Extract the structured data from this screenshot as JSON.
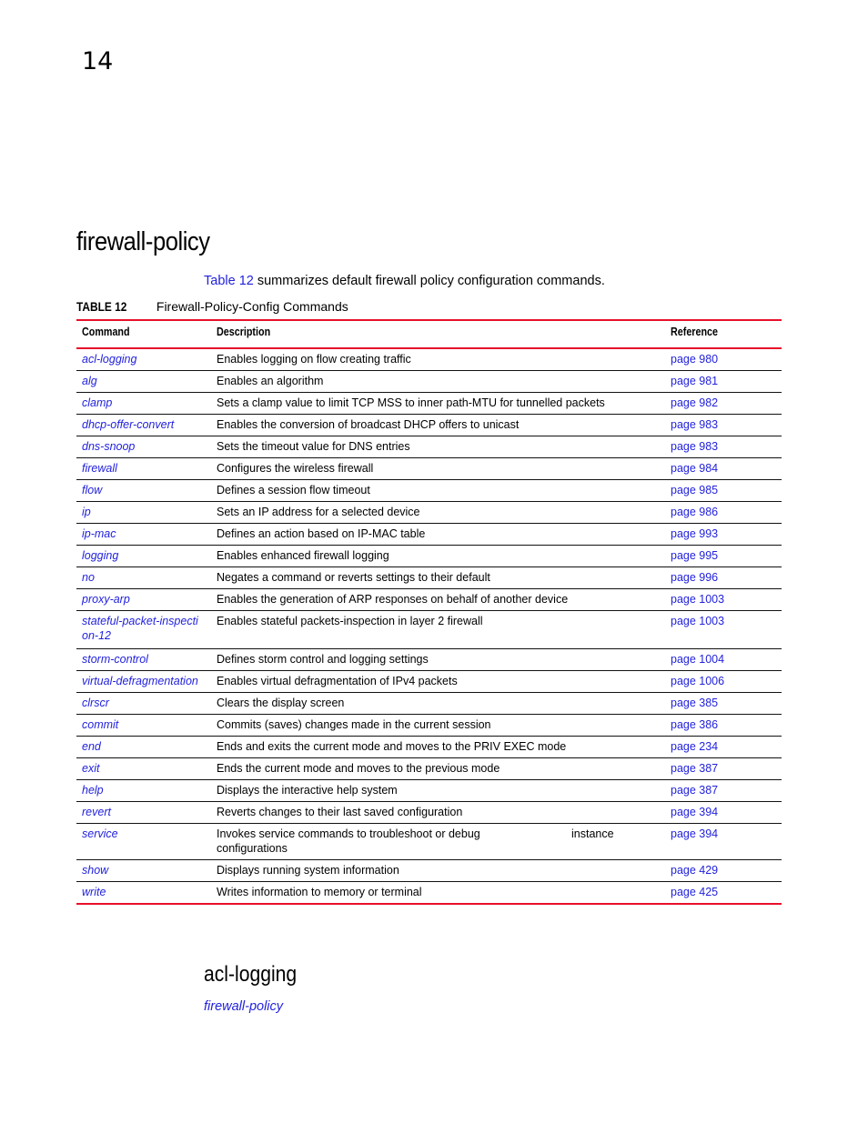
{
  "chapter_number": "14",
  "page_title": "firewall-policy",
  "intro": {
    "link_text": "Table 12",
    "text": " summarizes default firewall policy configuration commands."
  },
  "table": {
    "caption_label": "TABLE 12",
    "caption_title": "Firewall-Policy-Config Commands",
    "headers": [
      "Command",
      "Description",
      "Reference"
    ],
    "rows": [
      {
        "command": "acl-logging",
        "description": "Enables logging on flow creating traffic",
        "reference": "page 980"
      },
      {
        "command": "alg",
        "description": "Enables an algorithm",
        "reference": "page 981"
      },
      {
        "command": "clamp",
        "description": "Sets a clamp value to limit TCP MSS to inner path-MTU for tunnelled packets",
        "reference": "page 982"
      },
      {
        "command": "dhcp-offer-convert",
        "description": "Enables the conversion of broadcast DHCP offers to unicast",
        "reference": "page 983"
      },
      {
        "command": "dns-snoop",
        "description": "Sets the timeout value for DNS entries",
        "reference": "page 983"
      },
      {
        "command": "firewall",
        "description": "Configures the wireless firewall",
        "reference": "page 984"
      },
      {
        "command": "flow",
        "description": "Defines a session flow timeout",
        "reference": "page 985"
      },
      {
        "command": "ip",
        "description": "Sets an IP address for a selected device",
        "reference": "page 986"
      },
      {
        "command": "ip-mac",
        "description": "Defines an action based on IP-MAC table",
        "reference": "page 993"
      },
      {
        "command": "logging",
        "description": "Enables enhanced firewall logging",
        "reference": "page 995"
      },
      {
        "command": "no",
        "description": "Negates a command or reverts settings to their default",
        "reference": "page 996"
      },
      {
        "command": "proxy-arp",
        "description": "Enables the generation of ARP responses on behalf of another device",
        "reference": "page 1003"
      },
      {
        "command": "stateful-packet-inspection-12",
        "description": "Enables stateful packets-inspection in layer 2 firewall",
        "reference": "page 1003"
      },
      {
        "command": "storm-control",
        "description": "Defines storm control and logging settings",
        "reference": "page 1004"
      },
      {
        "command": "virtual-defragmentation",
        "description": "Enables virtual defragmentation of IPv4 packets",
        "reference": "page 1006"
      },
      {
        "command": "clrscr",
        "description": "Clears the display screen",
        "reference": "page 385"
      },
      {
        "command": "commit",
        "description": "Commits (saves) changes made in the current session",
        "reference": "page 386"
      },
      {
        "command": "end",
        "description": "Ends and exits the current mode and moves to the PRIV EXEC mode",
        "reference": "page 234"
      },
      {
        "command": "exit",
        "description": "Ends the current mode and moves to the previous mode",
        "reference": "page 387"
      },
      {
        "command": "help",
        "description": "Displays the interactive help system",
        "reference": "page 387"
      },
      {
        "command": "revert",
        "description": "Reverts changes to their last saved configuration",
        "reference": "page 394"
      },
      {
        "command": "service",
        "description": "Invokes service commands to troubleshoot or debug configurations",
        "extra": "instance",
        "reference": "page 394"
      },
      {
        "command": "show",
        "description": "Displays running system information",
        "reference": "page 429"
      },
      {
        "command": "write",
        "description": "Writes information to memory or terminal",
        "reference": "page 425"
      }
    ]
  },
  "section": {
    "title": "acl-logging",
    "link_text": "firewall-policy"
  },
  "colors": {
    "link": "#2222dd",
    "table_rule": "#e8102a"
  }
}
